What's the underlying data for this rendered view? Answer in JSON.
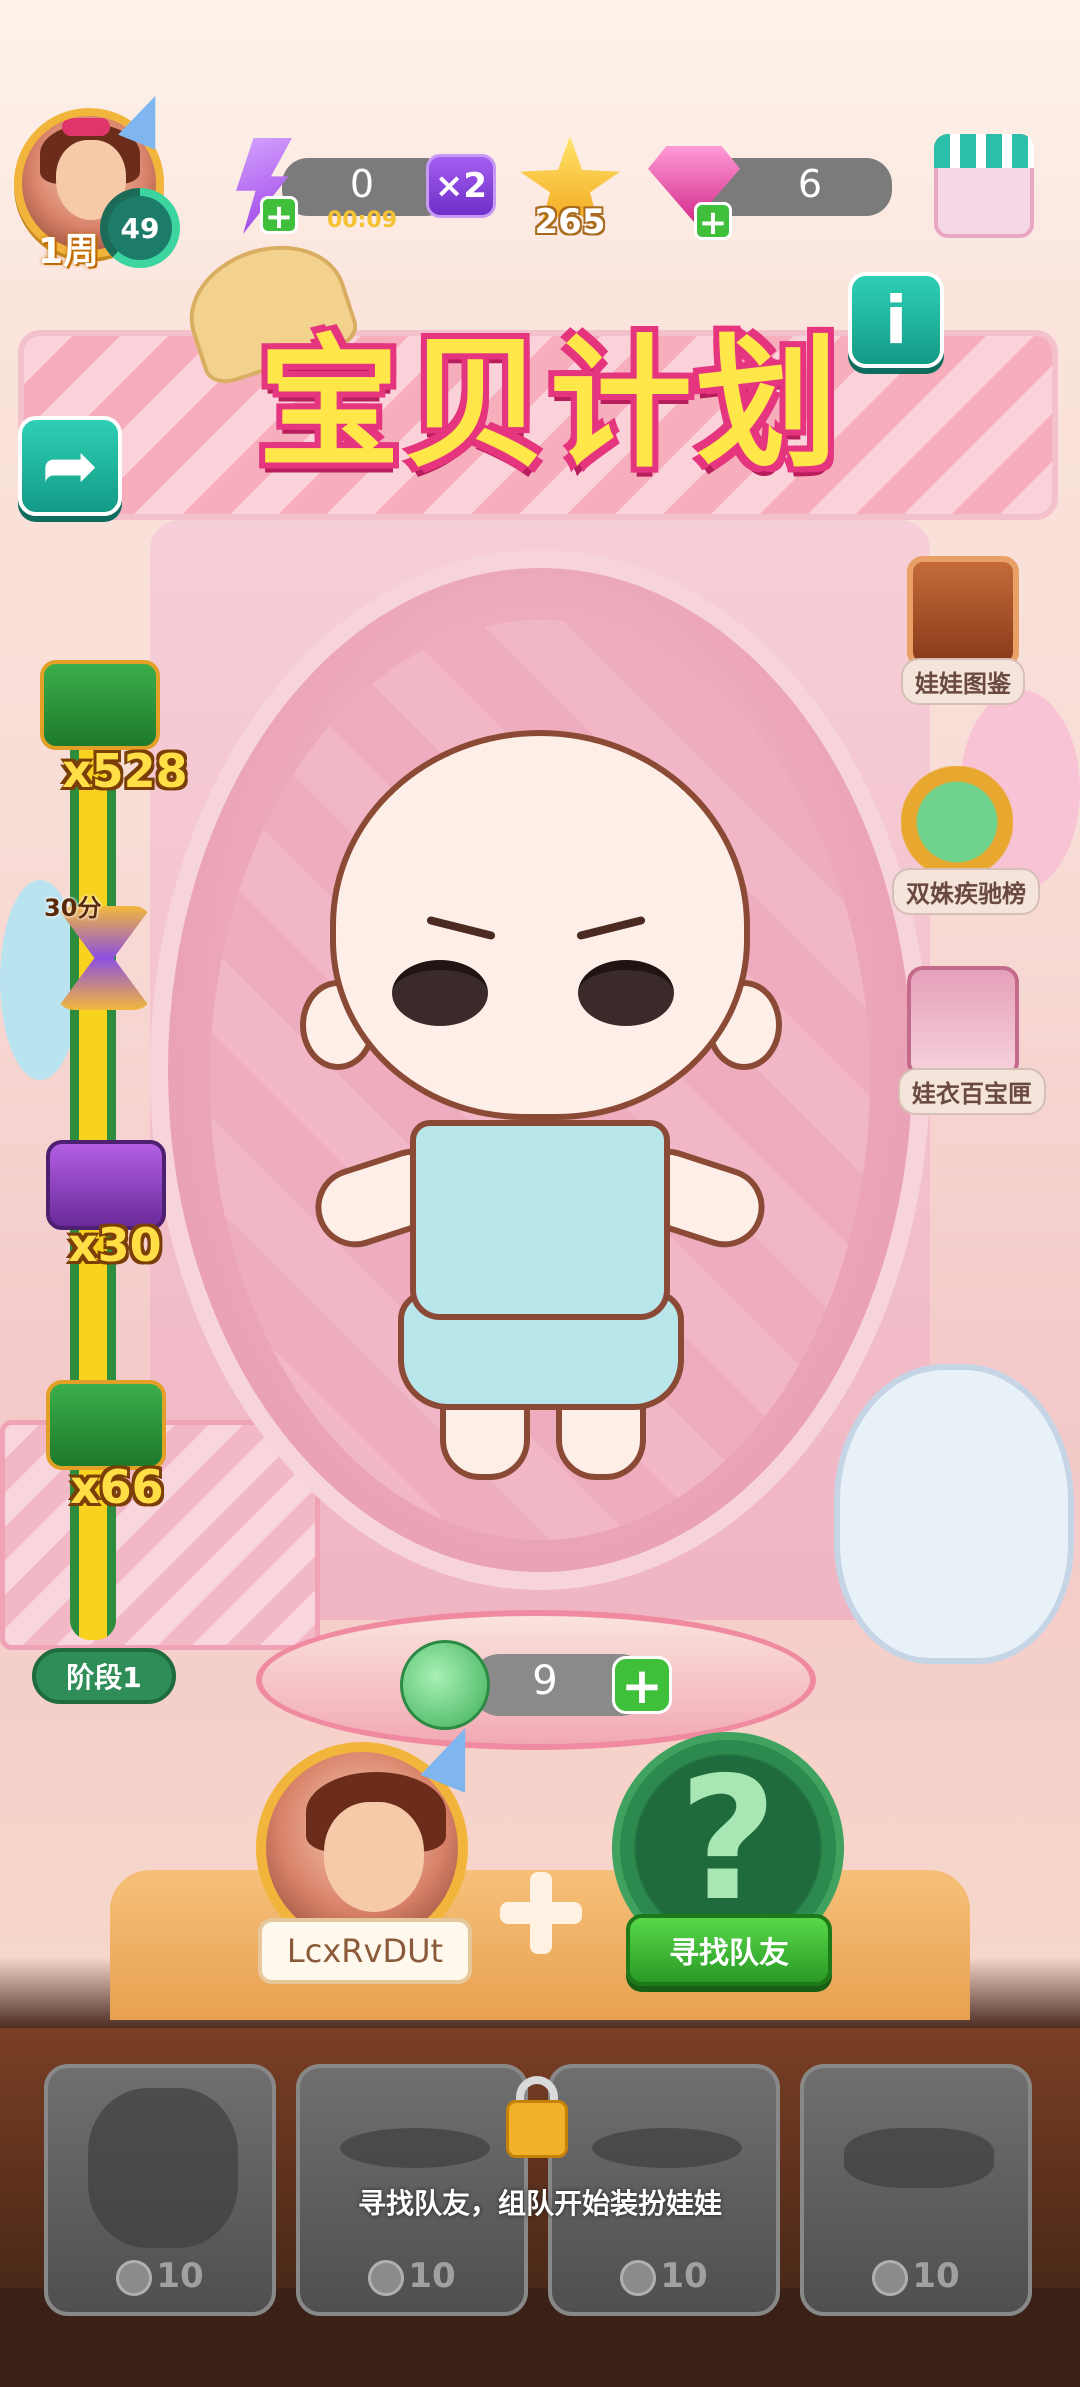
{
  "top_bar": {
    "player": {
      "week_badge": "1周",
      "level": "49"
    },
    "energy": {
      "value": "0",
      "timer": "00:09",
      "multiplier": "×2"
    },
    "stars": {
      "value": "265"
    },
    "gems": {
      "value": "6"
    }
  },
  "title": {
    "text": "宝贝计划"
  },
  "buttons": {
    "back_glyph": "➦",
    "info_glyph": "i"
  },
  "progress": {
    "rewards": [
      {
        "count": "x528",
        "type": "green-chest"
      },
      {
        "timer_label": "30分",
        "type": "hourglass"
      },
      {
        "count": "x30",
        "type": "purple-chest"
      },
      {
        "count": "x66",
        "type": "green-chest"
      }
    ],
    "stage_label": "阶段1"
  },
  "side_menu": [
    {
      "label": "娃娃图鉴",
      "icon": "doll-frame-icon"
    },
    {
      "label": "双姝疾驰榜",
      "icon": "yarn-trophy-icon"
    },
    {
      "label": "娃衣百宝匣",
      "icon": "wardrobe-icon"
    }
  ],
  "yarn": {
    "value": "9"
  },
  "team": {
    "player_name": "LcxRvDUt",
    "find_button": "寻找队友",
    "question_mark": "?"
  },
  "wardrobe": {
    "lock_hint": "寻找队友，组队开始装扮娃娃",
    "slots": [
      {
        "cost": "10",
        "item": "hair"
      },
      {
        "cost": "10",
        "item": "mouth"
      },
      {
        "cost": "10",
        "item": "blush"
      },
      {
        "cost": "10",
        "item": "eyes"
      }
    ]
  },
  "colors": {
    "accent_teal": "#139a86",
    "title_yellow": "#ffe74a",
    "title_pink": "#e5357e",
    "button_green": "#2a9a24"
  }
}
